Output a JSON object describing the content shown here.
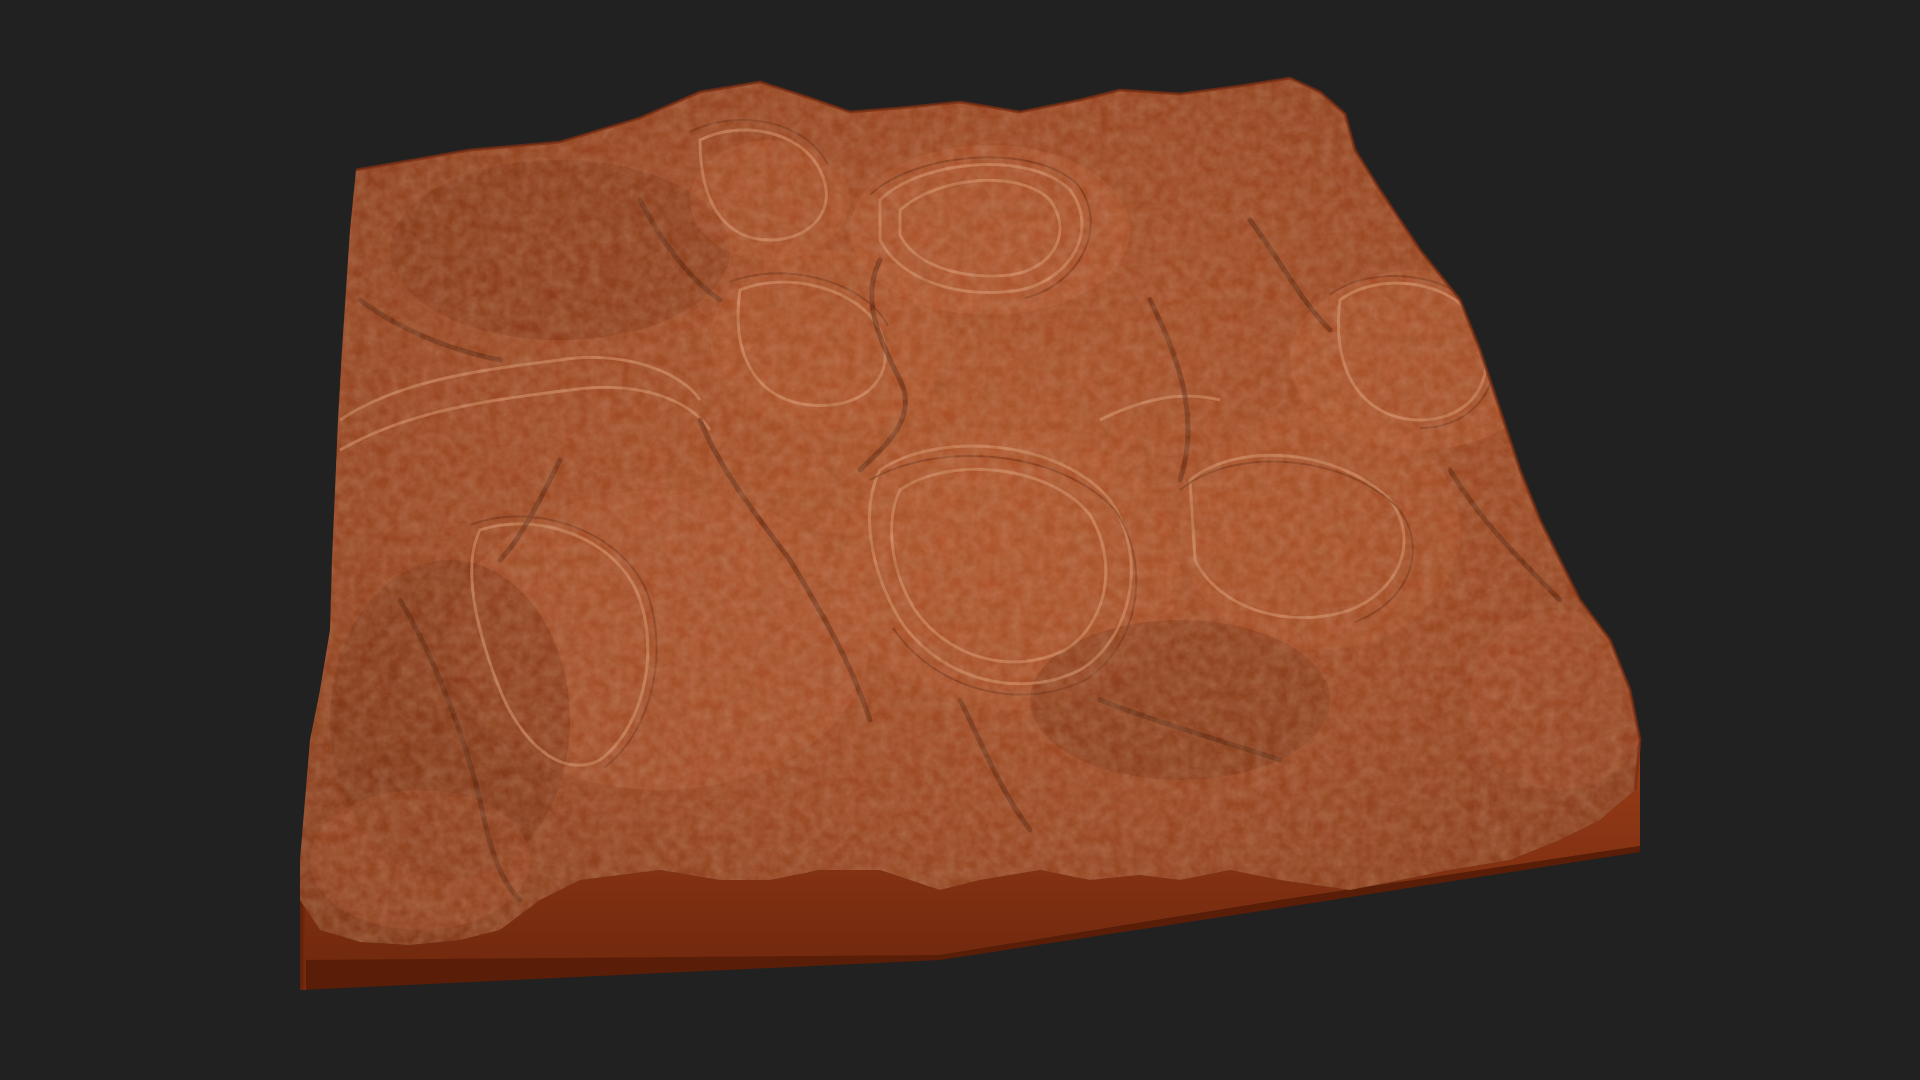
{
  "scene": {
    "background_color": "#212121",
    "subject": "terrain-block",
    "colors": {
      "terrain_base": "#8a3a1c",
      "terrain_mid": "#a24a24",
      "terrain_light": "#c8704a",
      "terrain_highlight": "#e0a07a",
      "terrain_shadow": "#4a1a0a",
      "side_face": "#8d3514",
      "side_face_dark": "#6e270d",
      "bottom_edge": "#5a1e08"
    }
  }
}
